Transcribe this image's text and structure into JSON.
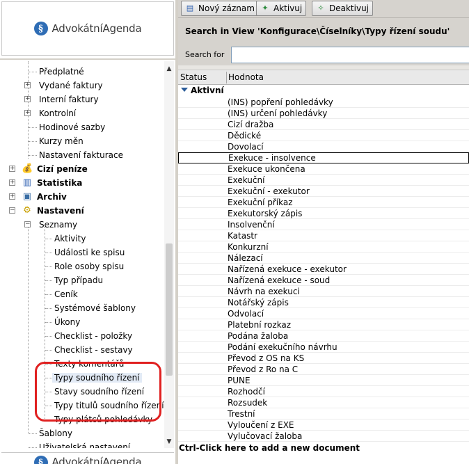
{
  "app": {
    "logo_brand": "Advokátní",
    "logo_brand2": "Agenda",
    "logo_mark": "§"
  },
  "toolbar": {
    "new_record": "Nový záznam",
    "activate": "Aktivuj",
    "deactivate": "Deaktivuj"
  },
  "search": {
    "title": "Search in View 'Konfigurace\\Číselníky\\Typy řízení soudu'",
    "label": "Search for",
    "value": ""
  },
  "grid": {
    "col_status": "Status",
    "col_value": "Hodnota",
    "group_label": "Aktivní",
    "rows": [
      "(INS) popření pohledávky",
      "(INS) určení pohledávky",
      "Cizí dražba",
      "Dědické",
      "Dovolací",
      "Exekuce - insolvence",
      "Exekuce ukončena",
      "Exekuční",
      "Exekuční - exekutor",
      "Exekuční příkaz",
      "Exekutorský zápis",
      "Insolvenční",
      "Katastr",
      "Konkurzní",
      "Nálezací",
      "Nařízená exekuce - exekutor",
      "Nařízená exekuce - soud",
      "Návrh na exekuci",
      "Notářský zápis",
      "Odvolací",
      "Platební rozkaz",
      "Podána žaloba",
      "Podání exekučního návrhu",
      "Převod z OS na KS",
      "Převod z Ro na C",
      "PUNE",
      "Rozhodčí",
      "Rozsudek",
      "Trestní",
      "Vyloučení z EXE",
      "Vylučovací žaloba"
    ],
    "focused_row": "Exekuce - insolvence",
    "footer_hint": "Ctrl-Click here to add a new document"
  },
  "tree": {
    "items": [
      {
        "label": "Předplatné"
      },
      {
        "label": "Vydané faktury"
      },
      {
        "label": "Interní faktury"
      },
      {
        "label": "Kontrolní"
      },
      {
        "label": "Hodinové sazby"
      },
      {
        "label": "Kurzy měn"
      },
      {
        "label": "Nastavení fakturace"
      },
      {
        "label": "Cizí peníze"
      },
      {
        "label": "Statistika"
      },
      {
        "label": "Archiv"
      },
      {
        "label": "Nastavení"
      },
      {
        "label": "Seznamy"
      },
      {
        "label": "Aktivity"
      },
      {
        "label": "Události ke spisu"
      },
      {
        "label": "Role osoby spisu"
      },
      {
        "label": "Typ případu"
      },
      {
        "label": "Ceník"
      },
      {
        "label": "Systémové šablony"
      },
      {
        "label": "Úkony"
      },
      {
        "label": "Checklist - položky"
      },
      {
        "label": "Checklist - sestavy"
      },
      {
        "label": "Texty komentářů"
      },
      {
        "label": "Typy soudního řízení"
      },
      {
        "label": "Stavy soudního řízení"
      },
      {
        "label": "Typy titulů soudního řízení"
      },
      {
        "label": "Typy plátců pohledávky"
      },
      {
        "label": "Šablony"
      },
      {
        "label": "Uživatelská nastavení"
      }
    ]
  },
  "colors": {
    "highlight_ring": "#e02020",
    "toolbar_bg": "#d6d3ce",
    "selected_bg": "#e3ebf6"
  }
}
